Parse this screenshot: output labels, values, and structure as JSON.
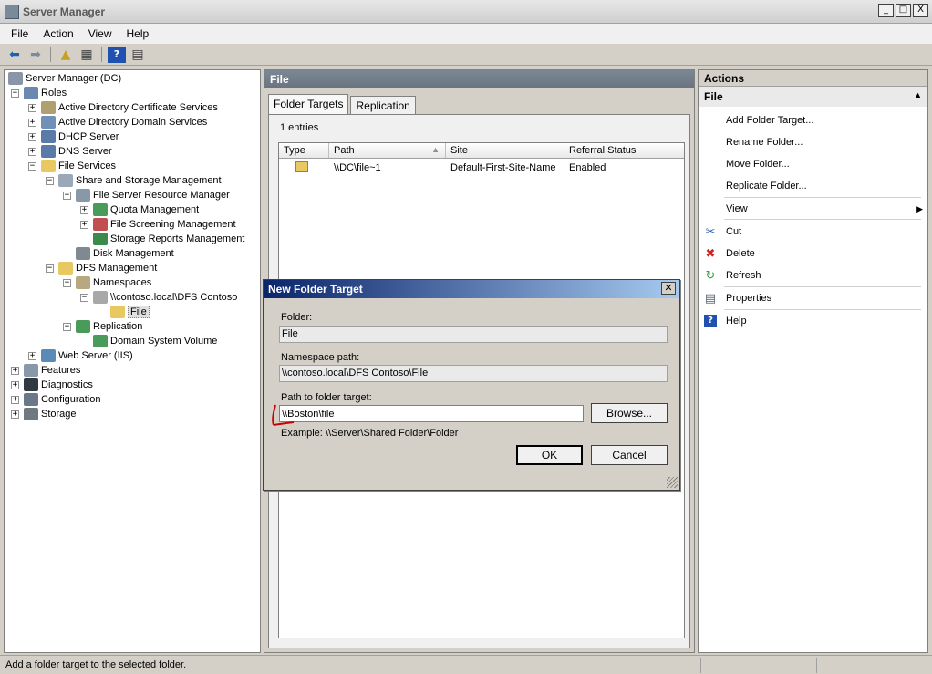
{
  "window": {
    "title": "Server Manager",
    "controls": [
      "_",
      "□",
      "X"
    ]
  },
  "menu": [
    "File",
    "Action",
    "View",
    "Help"
  ],
  "tree": {
    "root": "Server Manager (DC)",
    "roles": "Roles",
    "adcs": "Active Directory Certificate Services",
    "adds": "Active Directory Domain Services",
    "dhcp": "DHCP Server",
    "dns": "DNS Server",
    "file_services": "File Services",
    "share_storage": "Share and Storage Management",
    "fsrm": "File Server Resource Manager",
    "quota": "Quota Management",
    "screening": "File Screening Management",
    "storage_reports": "Storage Reports Management",
    "disk_mgmt": "Disk Management",
    "dfs": "DFS Management",
    "namespaces": "Namespaces",
    "namespace_contoso": "\\\\contoso.local\\DFS Contoso",
    "file": "File",
    "replication": "Replication",
    "dsv": "Domain System Volume",
    "iis": "Web Server (IIS)",
    "features": "Features",
    "diagnostics": "Diagnostics",
    "configuration": "Configuration",
    "storage": "Storage"
  },
  "middle": {
    "header": "File",
    "tabs": [
      "Folder Targets",
      "Replication"
    ],
    "entries": "1 entries",
    "columns": [
      "Type",
      "Path",
      "Site",
      "Referral Status"
    ],
    "rows": [
      {
        "path": "\\\\DC\\file~1",
        "site": "Default-First-Site-Name",
        "status": "Enabled"
      }
    ]
  },
  "actions": {
    "header": "Actions",
    "section": "File",
    "items": [
      "Add Folder Target...",
      "Rename Folder...",
      "Move Folder...",
      "Replicate Folder...",
      "View",
      "Cut",
      "Delete",
      "Refresh",
      "Properties",
      "Help"
    ]
  },
  "dialog": {
    "title": "New Folder Target",
    "folder_label": "Folder:",
    "folder_value": "File",
    "ns_label": "Namespace path:",
    "ns_value": "\\\\contoso.local\\DFS Contoso\\File",
    "path_label": "Path to folder target:",
    "path_value": "\\\\Boston\\file",
    "browse": "Browse...",
    "example": "Example: \\\\Server\\Shared Folder\\Folder",
    "ok": "OK",
    "cancel": "Cancel"
  },
  "status": {
    "text": "Add a folder target to the selected folder."
  },
  "colors": {
    "dialog_title_start": "#0a246a",
    "dialog_title_end": "#a6caf0",
    "annotation": "#cc0000"
  }
}
